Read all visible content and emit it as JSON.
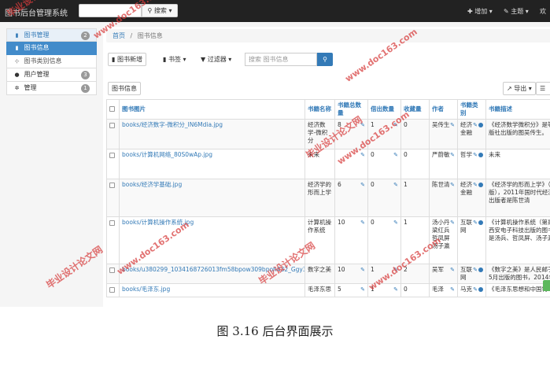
{
  "navbar": {
    "brand": "图书后台管理系统",
    "search_button": "搜索",
    "add_menu": "增加",
    "theme_menu": "主题",
    "user_menu": "欢"
  },
  "sidebar": {
    "items": [
      {
        "label": "图书管理",
        "badge": "2"
      },
      {
        "label": "图书信息"
      },
      {
        "label": "图书类别信息"
      },
      {
        "label": "用户管理",
        "badge": "3"
      },
      {
        "label": "管理",
        "badge": "1"
      }
    ]
  },
  "breadcrumb": {
    "home": "首页",
    "separator": "/",
    "current": "图书信息"
  },
  "toolbar": {
    "new_button": "图书新增",
    "bookmark_menu": "书签",
    "filter_menu": "过滤器",
    "search_placeholder": "搜索 图书信息"
  },
  "tabs": {
    "active": "图书信息",
    "export_button": "导出"
  },
  "table": {
    "headers": [
      "图书图片",
      "书籍名称",
      "书籍总数量",
      "借出数量",
      "收藏量",
      "作者",
      "书籍类别",
      "书籍描述"
    ],
    "rows": [
      {
        "image": "books/经济数字-微积分_lN6Mdia.jpg",
        "name": "经济数学-微积分",
        "total": "8",
        "lent": "1",
        "fav": "0",
        "author": "吴传生",
        "category": "经济金融",
        "desc": "《经济数学微积分》是等教育出版社出版的图吴传生。"
      },
      {
        "image": "books/计算机网络_80S0wAp.jpg",
        "name": "未来",
        "total": "",
        "lent": "0",
        "fav": "0",
        "author": "严蔚敏",
        "category": "哲学",
        "desc": "未来"
      },
      {
        "image": "books/经济学基础.jpg",
        "name": "经济学的形而上学",
        "total": "6",
        "lent": "0",
        "fav": "1",
        "author": "陈世清",
        "category": "经济金融",
        "desc": "《经济学的形而上学》（第一版），2011年国时代经济出版社出版者是陈世清"
      },
      {
        "image": "books/计算机操作系统.jpg",
        "name": "计算机操作系统",
        "total": "10",
        "lent": "0",
        "fav": "1",
        "author": "汤小丹 梁红兵 哲凤屏 汤子瀛",
        "category": "互联网",
        "desc": "《计算机操作系统（第是2016年西安电子科技出版的图书，作者是汤兵、哲凤屏、汤子瀛"
      },
      {
        "image": "books/u380299_1034168726013fm58bpow309bpoh432_Ggy3key.jpg",
        "name": "数字之美",
        "total": "10",
        "lent": "1",
        "fav": "2",
        "author": "吴军",
        "category": "互联网",
        "desc": "《数字之美》是人民邮于2012年5月出版的图书，2014年再版。"
      },
      {
        "image": "books/毛泽东.jpg",
        "name": "毛泽东思",
        "total": "5",
        "lent": "1",
        "fav": "0",
        "author": "毛泽",
        "category": "马克",
        "desc": "《毛泽东思想和中国特"
      }
    ]
  },
  "watermark": {
    "cn": "毕业设计论文网",
    "url": "www.doc163.com"
  },
  "caption": "图 3.16  后台界面展示",
  "colors": {
    "accent": "#337ab7",
    "active": "#428bca",
    "watermark": "#d73c3c"
  }
}
